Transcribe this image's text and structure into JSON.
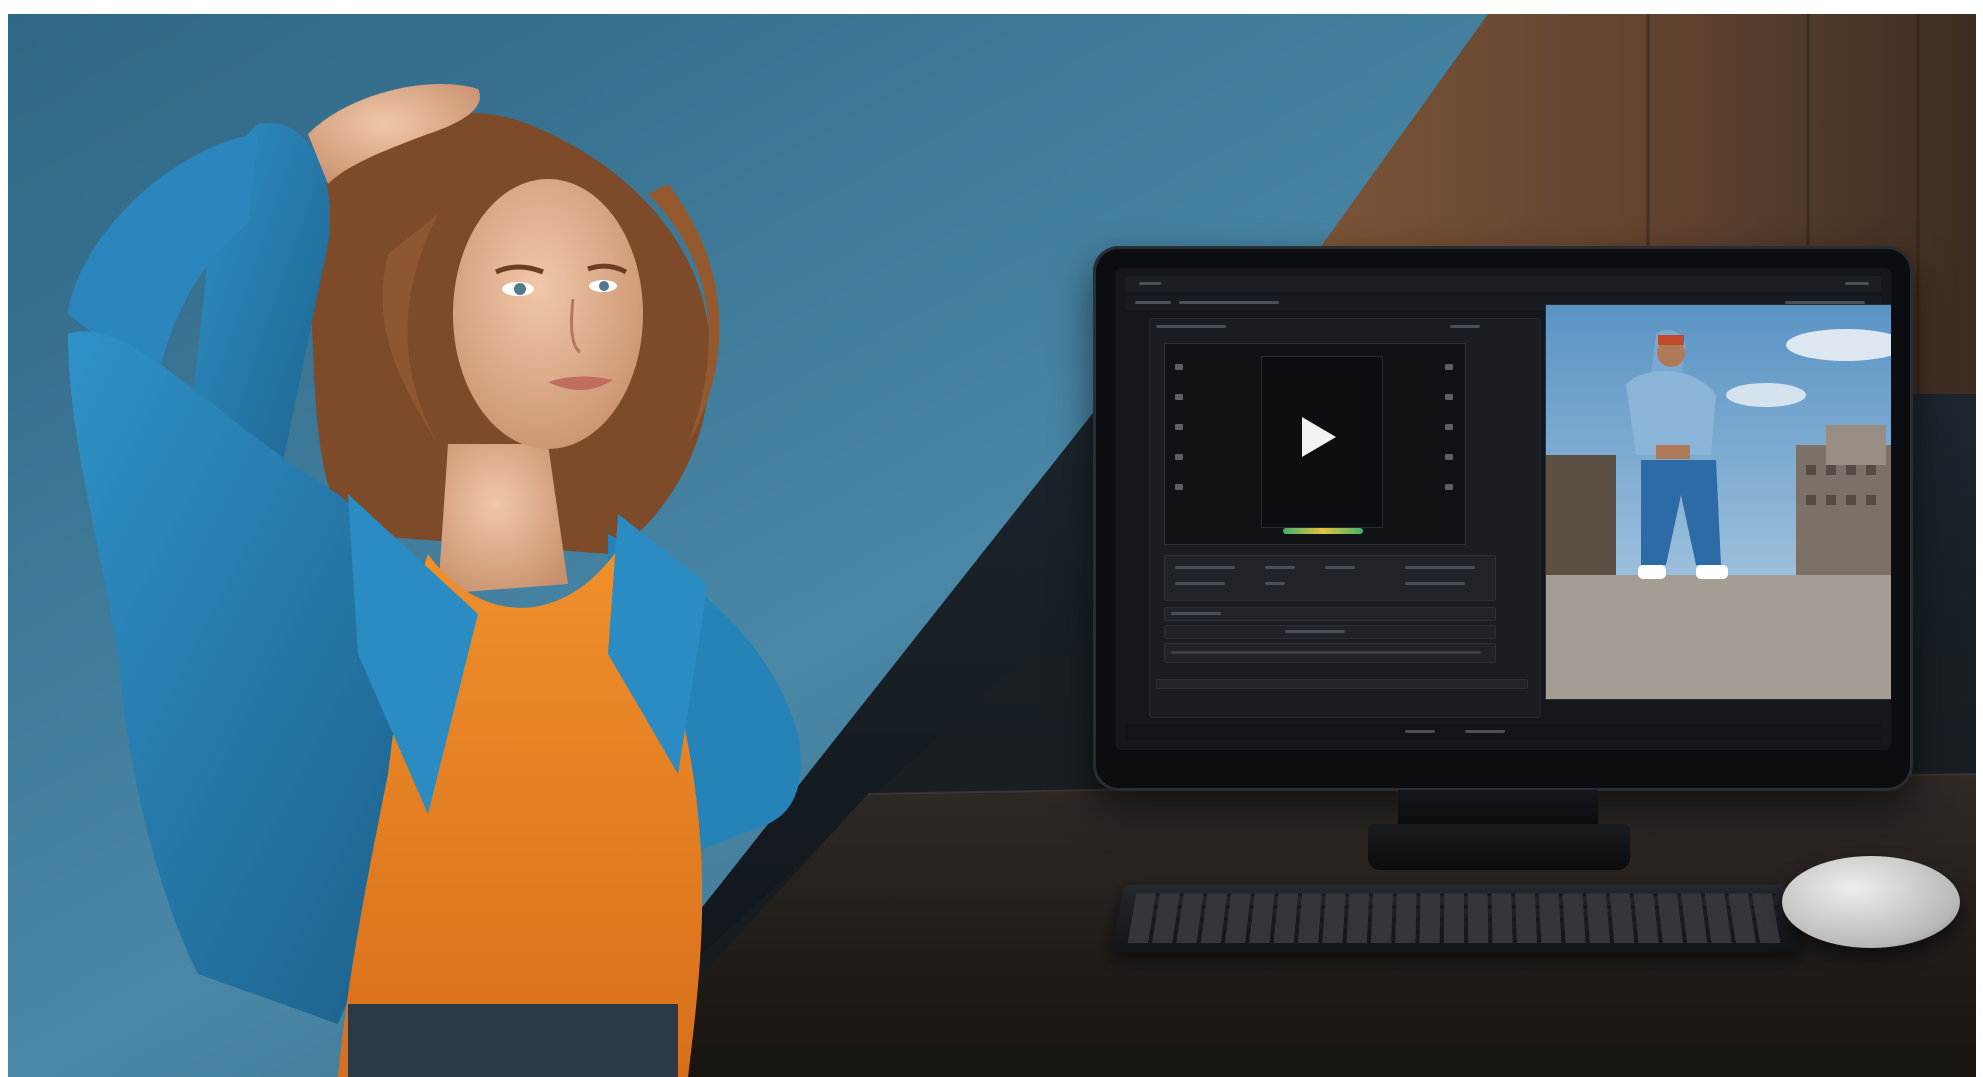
{
  "image": {
    "subject": "woman-and-video-editor-monitor",
    "colors": {
      "left_background": "#3f7a98",
      "jacket": "#2f8bc0",
      "shirt": "#ef8a2a",
      "hair": "#8a5230",
      "wood_wall": "#6b4a33",
      "desk": "#2a2522"
    }
  },
  "monitor": {
    "editor": {
      "play_icon": "play-icon",
      "timeline_colors": [
        "#3fb46a",
        "#e6c23d"
      ],
      "marker_color": "#d9473a"
    },
    "preview": {
      "sky": "#6fa5cf",
      "pants": "#2d6aa8",
      "ground": "#a9a49b"
    }
  }
}
